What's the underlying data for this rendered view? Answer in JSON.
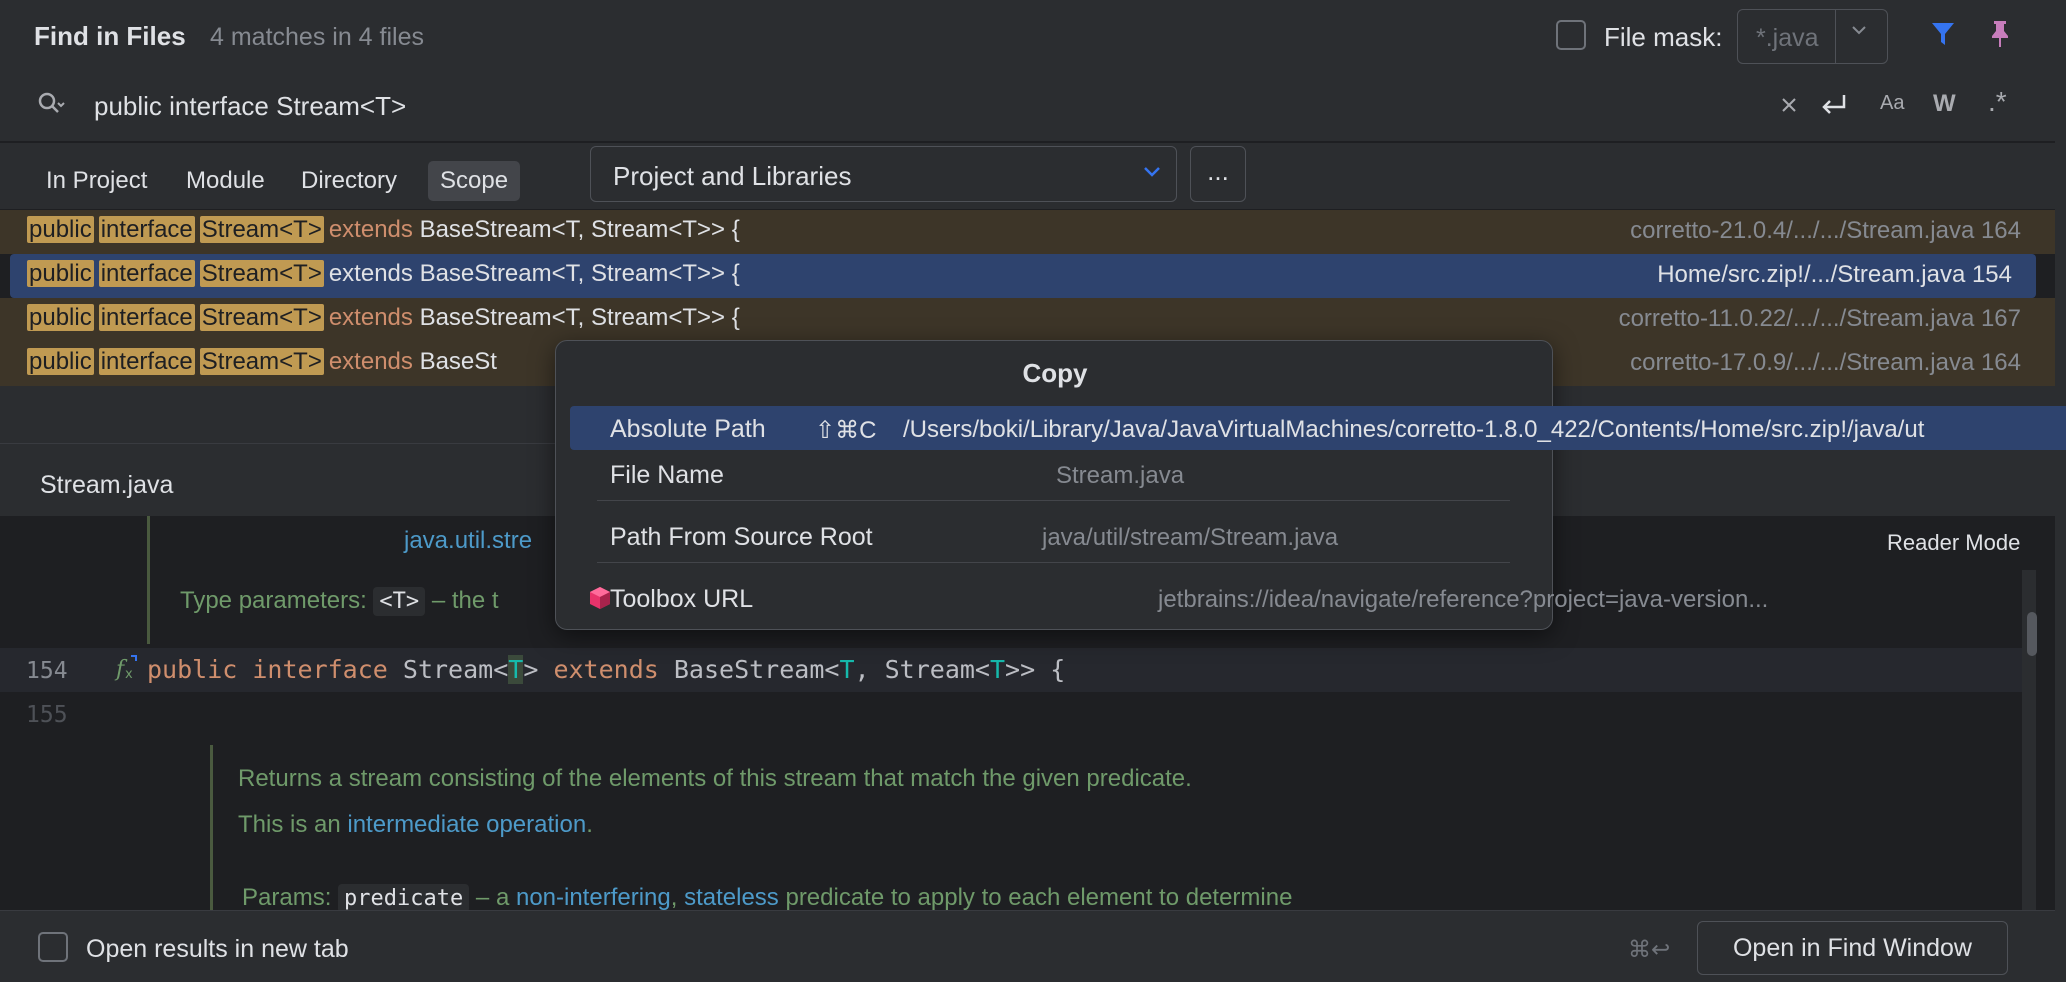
{
  "header": {
    "title": "Find in Files",
    "match_count": "4 matches in 4 files",
    "file_mask_label": "File mask:",
    "file_mask_value": "*.java"
  },
  "search": {
    "query": "public interface Stream<T>"
  },
  "scope_tabs": [
    {
      "label": "In Project"
    },
    {
      "label": "Module"
    },
    {
      "label": "Directory"
    },
    {
      "label": "Scope",
      "active": true
    }
  ],
  "scope_select": "Project and Libraries",
  "more_button": "...",
  "results": [
    {
      "hl": [
        "public",
        "interface",
        "Stream<T>"
      ],
      "kw": "extends",
      "rest": "BaseStream<T, Stream<T>> {",
      "file": "corretto-21.0.4/.../.../Stream.java 164"
    },
    {
      "hl": [
        "public",
        "interface",
        "Stream<T>"
      ],
      "kw": "extends",
      "rest": "BaseStream<T, Stream<T>> {",
      "file": "Home/src.zip!/.../Stream.java 154"
    },
    {
      "hl": [
        "public",
        "interface",
        "Stream<T>"
      ],
      "kw": "extends",
      "rest": "BaseStream<T, Stream<T>> {",
      "file": "corretto-11.0.22/.../.../Stream.java 167"
    },
    {
      "hl": [
        "public",
        "interface",
        "Stream<T>"
      ],
      "kw": "extends",
      "rest": "BaseSt",
      "file": "corretto-17.0.9/.../.../Stream.java 164"
    }
  ],
  "preview": {
    "filename": "Stream.java",
    "reader_mode": "Reader Mode",
    "doc_top_link": "java.util.stre",
    "type_params_label": "Type parameters:",
    "type_params_code": "<T>",
    "type_params_rest": "– the t",
    "line_154": "154",
    "line_155": "155",
    "code": {
      "kw1": "public",
      "kw2": "interface",
      "name": "Stream<",
      "tp": "T",
      "close": ">",
      "kw3": "extends",
      "base": "BaseStream<",
      "tp2": "T",
      "mid": ", Stream<",
      "tp3": "T",
      "end": ">> {"
    },
    "doc1": "Returns a stream consisting of the elements of this stream that match the given predicate.",
    "doc2_prefix": "This is an",
    "doc2_link": "intermediate operation",
    "doc2_suffix": ".",
    "params_label": "Params:",
    "params_code": "predicate",
    "params_dash": "– a",
    "params_link1": "non-interfering",
    "params_comma": ",",
    "params_link2": "stateless",
    "params_rest": "predicate to apply to each element to determine"
  },
  "copy_popup": {
    "title": "Copy",
    "items": [
      {
        "label": "Absolute Path",
        "shortcut": "⇧⌘C",
        "value": "/Users/boki/Library/Java/JavaVirtualMachines/corretto-1.8.0_422/Contents/Home/src.zip!/java/ut"
      },
      {
        "label": "File Name",
        "value": "Stream.java"
      },
      {
        "label": "Path From Source Root",
        "value": "java/util/stream/Stream.java"
      },
      {
        "label": "Toolbox URL",
        "value": "jetbrains://idea/navigate/reference?project=java-version..."
      }
    ]
  },
  "footer": {
    "checkbox_label": "Open results in new tab",
    "shortcut": "⌘↩",
    "button": "Open in Find Window"
  },
  "colors": {
    "accent": "#3574f0",
    "pin": "#c77dbb",
    "highlight": "#c09a52",
    "selection": "#2e436e"
  }
}
